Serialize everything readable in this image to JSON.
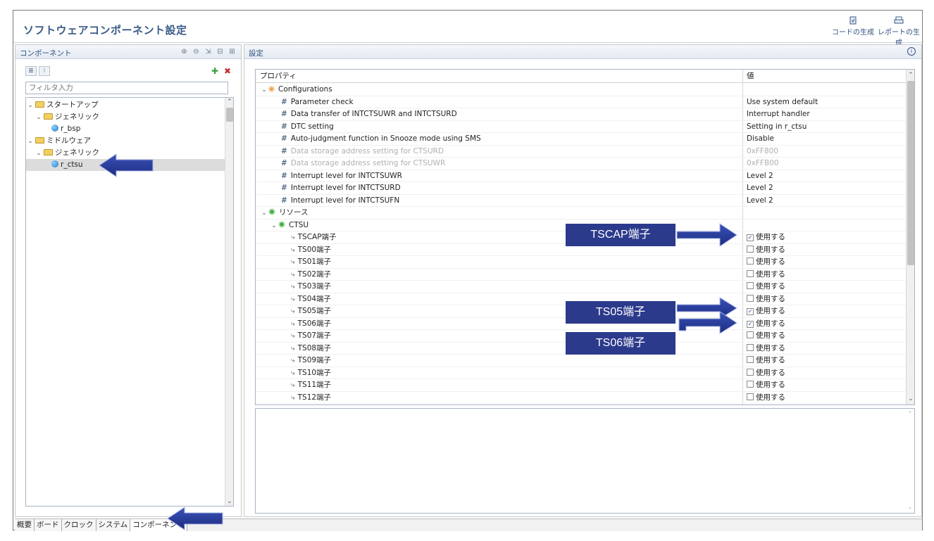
{
  "app_title": "ソフトウェアコンポーネント設定",
  "toolbar": {
    "generate_code": "コードの生成",
    "generate_report": "レポートの生成"
  },
  "left_panel": {
    "title": "コンポーネント",
    "filter_placeholder": "フィルタ入力",
    "tree": [
      {
        "label": "スタートアップ",
        "level": 0,
        "type": "folder",
        "expanded": true
      },
      {
        "label": "ジェネリック",
        "level": 1,
        "type": "folder",
        "expanded": true
      },
      {
        "label": "r_bsp",
        "level": 2,
        "type": "component"
      },
      {
        "label": "ミドルウェア",
        "level": 0,
        "type": "folder",
        "expanded": true
      },
      {
        "label": "ジェネリック",
        "level": 1,
        "type": "folder",
        "expanded": true
      },
      {
        "label": "r_ctsu",
        "level": 2,
        "type": "component",
        "selected": true
      }
    ]
  },
  "bottom_tabs": [
    "概要",
    "ボード",
    "クロック",
    "システム",
    "コンポーネント"
  ],
  "right_panel": {
    "title": "設定",
    "col_property": "プロパティ",
    "col_value": "値",
    "rows": [
      {
        "name": "Configurations",
        "value": "",
        "level": 0,
        "kind": "group-config"
      },
      {
        "name": "Parameter check",
        "value": "Use system default",
        "level": 1,
        "kind": "param"
      },
      {
        "name": "Data transfer of INTCTSUWR and INTCTSURD",
        "value": "Interrupt handler",
        "level": 1,
        "kind": "param"
      },
      {
        "name": "DTC setting",
        "value": "Setting in r_ctsu",
        "level": 1,
        "kind": "param"
      },
      {
        "name": "Auto-judgment function in Snooze mode using SMS",
        "value": "Disable",
        "level": 1,
        "kind": "param"
      },
      {
        "name": "Data storage address setting for CTSURD",
        "value": "0xFF800",
        "level": 1,
        "kind": "param",
        "disabled": true
      },
      {
        "name": "Data storage address setting for CTSUWR",
        "value": "0xFFB00",
        "level": 1,
        "kind": "param",
        "disabled": true
      },
      {
        "name": "Interrupt level for INTCTSUWR",
        "value": "Level 2",
        "level": 1,
        "kind": "param"
      },
      {
        "name": "Interrupt level for INTCTSURD",
        "value": "Level 2",
        "level": 1,
        "kind": "param"
      },
      {
        "name": "Interrupt level for INTCTSUFN",
        "value": "Level 2",
        "level": 1,
        "kind": "param"
      },
      {
        "name": "リソース",
        "value": "",
        "level": 0,
        "kind": "group-resource"
      },
      {
        "name": "CTSU",
        "value": "",
        "level": 1,
        "kind": "group-resource"
      },
      {
        "name": "TSCAP端子",
        "value": "使用する",
        "level": 2,
        "kind": "pin",
        "checked": true
      },
      {
        "name": "TS00端子",
        "value": "使用する",
        "level": 2,
        "kind": "pin",
        "checked": false
      },
      {
        "name": "TS01端子",
        "value": "使用する",
        "level": 2,
        "kind": "pin",
        "checked": false
      },
      {
        "name": "TS02端子",
        "value": "使用する",
        "level": 2,
        "kind": "pin",
        "checked": false
      },
      {
        "name": "TS03端子",
        "value": "使用する",
        "level": 2,
        "kind": "pin",
        "checked": false
      },
      {
        "name": "TS04端子",
        "value": "使用する",
        "level": 2,
        "kind": "pin",
        "checked": false
      },
      {
        "name": "TS05端子",
        "value": "使用する",
        "level": 2,
        "kind": "pin",
        "checked": true
      },
      {
        "name": "TS06端子",
        "value": "使用する",
        "level": 2,
        "kind": "pin",
        "checked": true
      },
      {
        "name": "TS07端子",
        "value": "使用する",
        "level": 2,
        "kind": "pin",
        "checked": false
      },
      {
        "name": "TS08端子",
        "value": "使用する",
        "level": 2,
        "kind": "pin",
        "checked": false
      },
      {
        "name": "TS09端子",
        "value": "使用する",
        "level": 2,
        "kind": "pin",
        "checked": false
      },
      {
        "name": "TS10端子",
        "value": "使用する",
        "level": 2,
        "kind": "pin",
        "checked": false
      },
      {
        "name": "TS11端子",
        "value": "使用する",
        "level": 2,
        "kind": "pin",
        "checked": false
      },
      {
        "name": "TS12端子",
        "value": "使用する",
        "level": 2,
        "kind": "pin",
        "checked": false
      }
    ]
  },
  "annotations": {
    "tscap": "TSCAP端子",
    "ts05": "TS05端子",
    "ts06": "TS06端子"
  },
  "colors": {
    "callout_bg": "#2c3a8c",
    "arrow_fill": "#2a3f9a",
    "title_color": "#3a5a86"
  }
}
